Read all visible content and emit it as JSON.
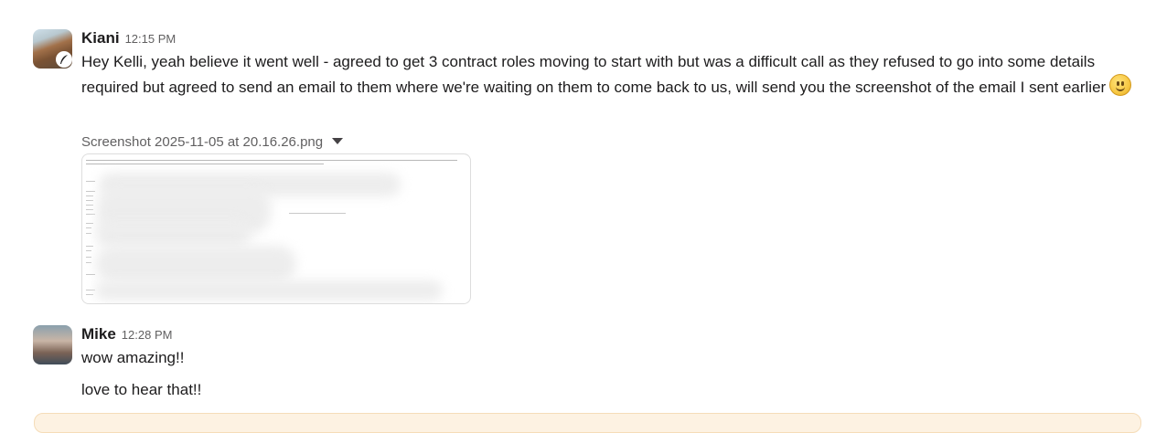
{
  "messages": [
    {
      "sender": "Kiani",
      "time": "12:15 PM",
      "text": "Hey Kelli, yeah believe it went well - agreed to get 3 contract roles moving to start with but was a difficult call as they refused to go into some details required but agreed to send an email to them where we're waiting on them to come back to us, will send you the screenshot of the email I sent earlier",
      "emoji": "slightly-smiling-face",
      "attachment": {
        "filename": "Screenshot 2025-11-05 at 20.16.26.png"
      }
    },
    {
      "sender": "Mike",
      "time": "12:28 PM",
      "text": "wow amazing!!",
      "followup": "love to hear that!!"
    }
  ],
  "icons": {
    "status": "quill-icon",
    "attachment_toggle": "caret-down-icon"
  },
  "colors": {
    "sender": "#1d1c1d",
    "timestamp": "#616061",
    "banner": "#fdf2e2"
  }
}
